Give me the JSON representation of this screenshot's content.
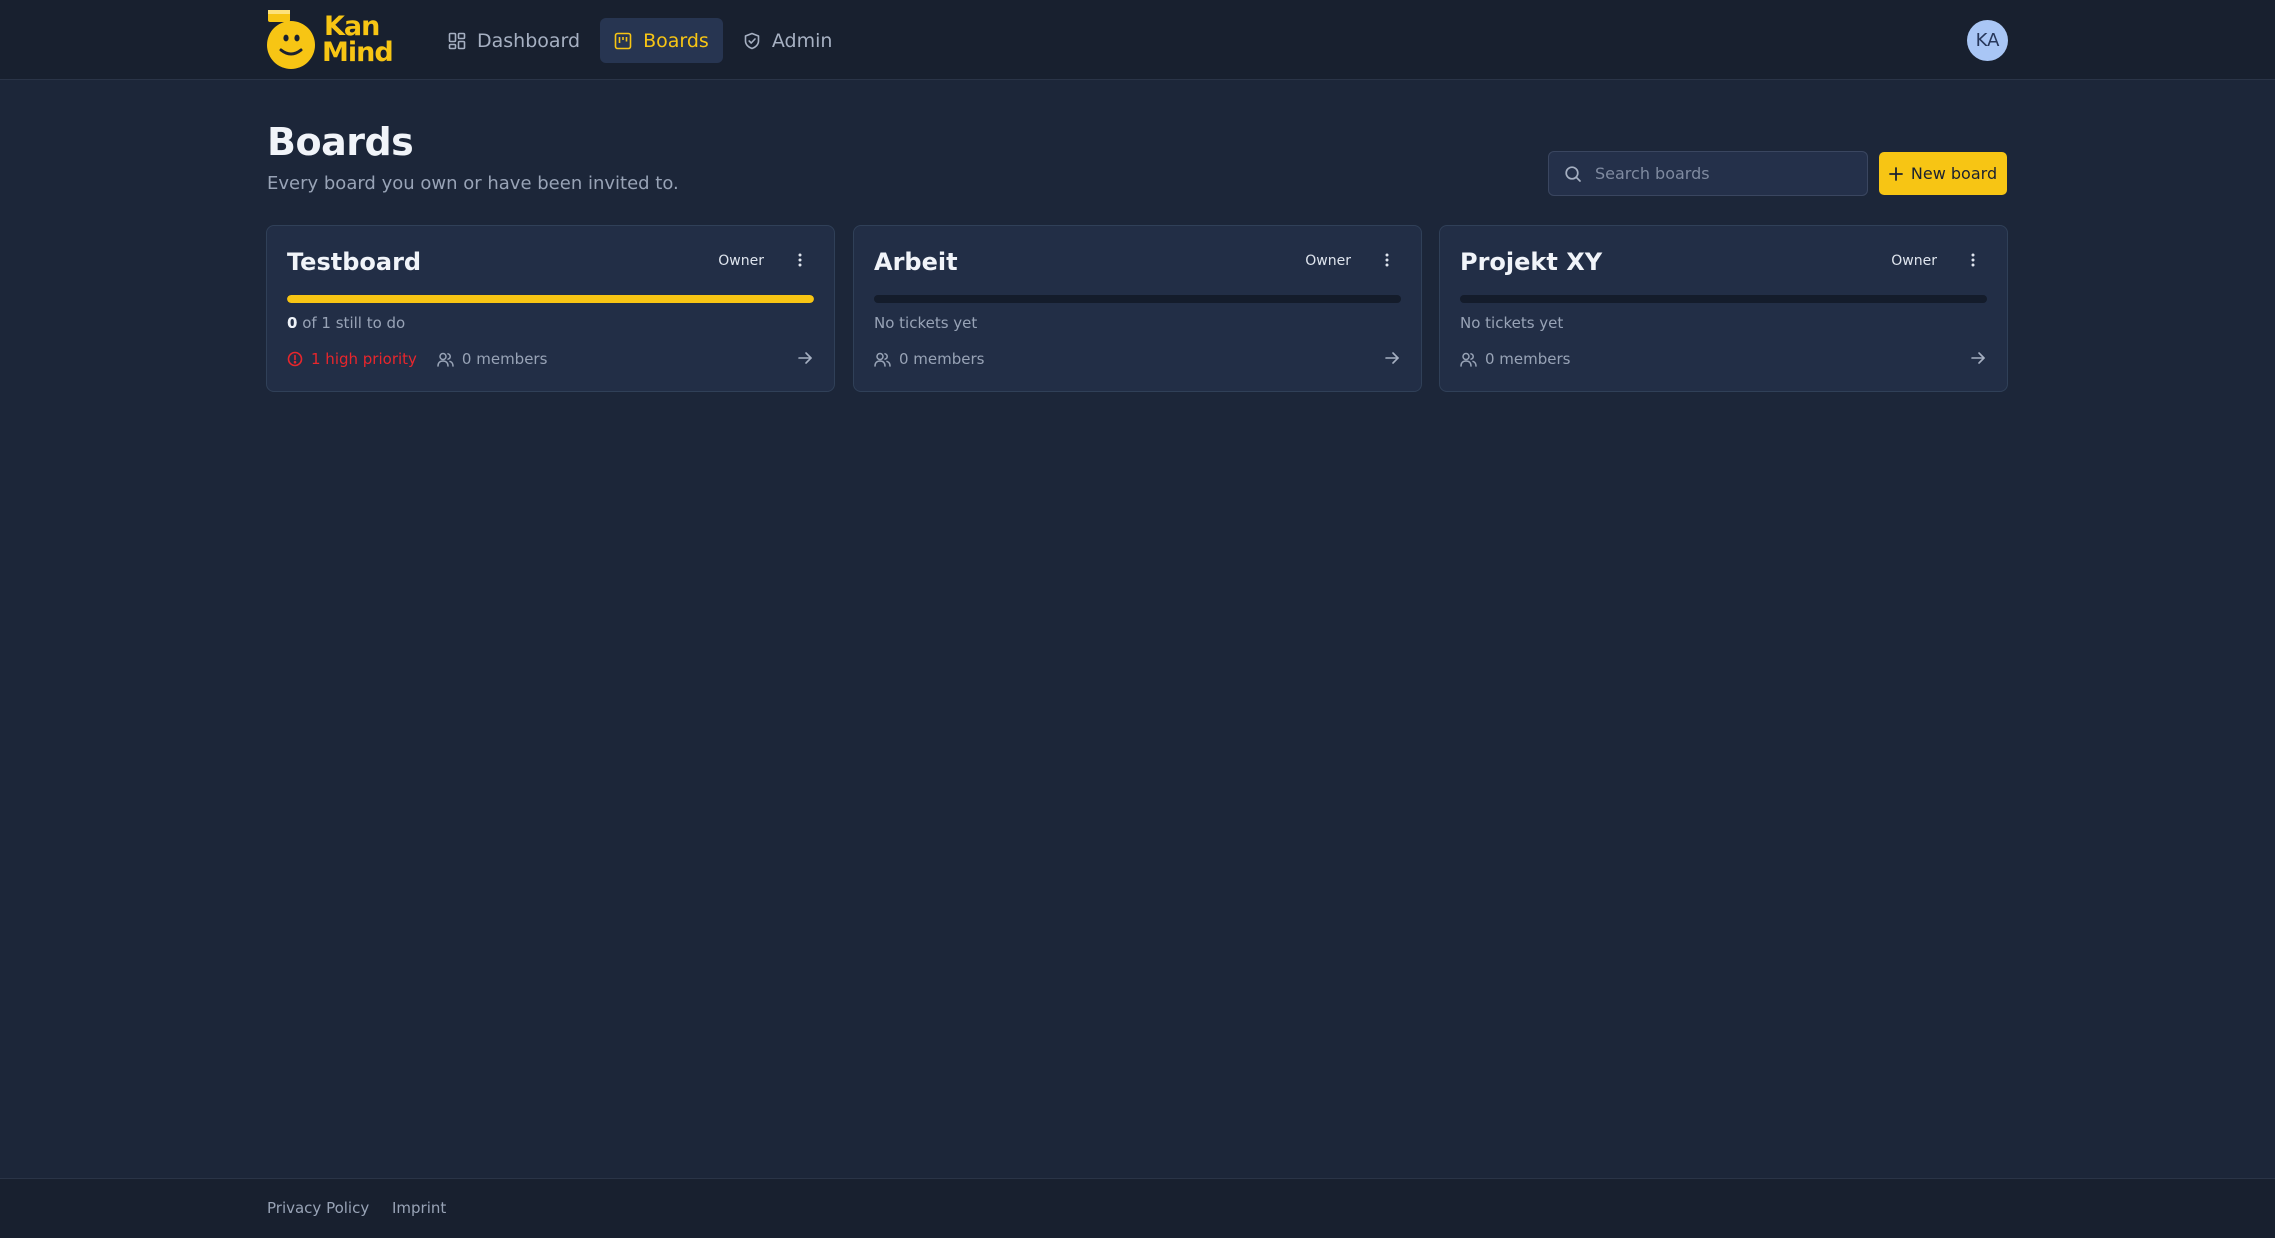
{
  "brand": {
    "logo_line1": "Kan",
    "logo_line2": "Mind",
    "logo_icon": "smiley-mascot-icon",
    "accent_color": "#f7c514"
  },
  "nav": {
    "items": [
      {
        "label": "Dashboard",
        "icon": "dashboard-icon",
        "active": false
      },
      {
        "label": "Boards",
        "icon": "board-icon",
        "active": true
      },
      {
        "label": "Admin",
        "icon": "shield-icon",
        "active": false
      }
    ]
  },
  "user": {
    "initials": "KA"
  },
  "page": {
    "title": "Boards",
    "subtitle": "Every board you own or have been invited to."
  },
  "search": {
    "placeholder": "Search boards",
    "value": ""
  },
  "actions": {
    "new_board_label": "New board"
  },
  "boards": [
    {
      "title": "Testboard",
      "role": "Owner",
      "progress": 1.0,
      "open_count": "0",
      "status_rest": " of 1 still to do",
      "priority": "1 high priority",
      "members": "0 members"
    },
    {
      "title": "Arbeit",
      "role": "Owner",
      "progress": 0,
      "status": "No tickets yet",
      "members": "0 members"
    },
    {
      "title": "Projekt XY",
      "role": "Owner",
      "progress": 0,
      "status": "No tickets yet",
      "members": "0 members"
    }
  ],
  "footer": {
    "privacy": "Privacy Policy",
    "imprint": "Imprint"
  },
  "colors": {
    "background": "#1c2639",
    "card": "#222e46",
    "priority_red": "#e8262c"
  }
}
